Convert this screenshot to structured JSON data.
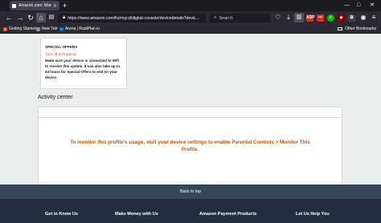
{
  "browser": {
    "tab_title": "Amazon.com: Manage Your C...",
    "new_tab_symbol": "+",
    "url": "https://www.amazon.com/hz/mycd/digital-console/devicedetails?devic...",
    "search_placeholder": "Search",
    "extensions": [
      {
        "name": "abp-icon",
        "label": "ABP",
        "color": "#d32d27"
      },
      {
        "name": "lastpass-icon",
        "label": "•••",
        "color": "#d32d27"
      },
      {
        "name": "check-icon",
        "label": "✓",
        "color": "#12bc00"
      },
      {
        "name": "ublock-icon",
        "label": "◆",
        "color": "#800000"
      },
      {
        "name": "puzzle-icon",
        "label": "⧉",
        "color": "#42414d"
      }
    ]
  },
  "bookmarks": {
    "items": [
      {
        "label": "Getting Started",
        "icon_color": "#ff7139"
      },
      {
        "label": "New Tab",
        "icon_color": "#8f8f9d"
      },
      {
        "label": "Arena | RaidPlan.io",
        "icon_color": "#0a84ff"
      }
    ],
    "other_label": "Other Bookmarks"
  },
  "special_offers": {
    "title": "SPECIAL OFFERS",
    "status": "Turn off in Progress",
    "description": "Make sure your device is connected to Wifi to receive this update. It can also take up to 24 hours for Special Offers to end on your device."
  },
  "activity": {
    "title": "Activity center",
    "message": "To monitor this profile's usage, visit your device settings to enable Parental Controls > Monitor This Profile."
  },
  "footer": {
    "back_to_top": "Back to top",
    "columns": [
      "Get to Know Us",
      "Make Money with Us",
      "Amazon Payment Products",
      "Let Us Help You"
    ]
  },
  "colors": {
    "accent_orange": "#c45500",
    "footer_bg": "#232f3e",
    "back_to_top_bg": "#37475a"
  }
}
